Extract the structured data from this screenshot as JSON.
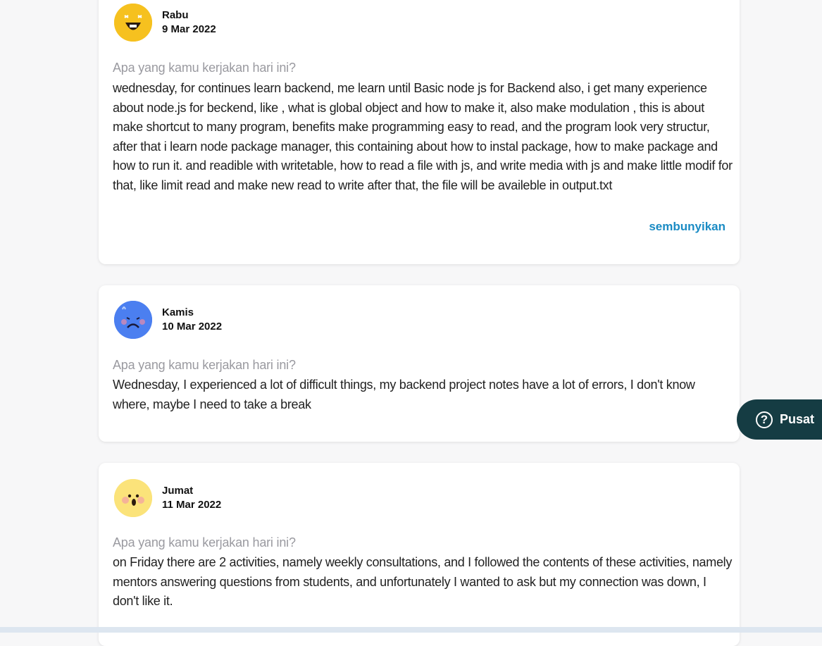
{
  "question_label": "Apa yang kamu kerjakan hari ini?",
  "entries": [
    {
      "mood_icon": "laughing-face-icon",
      "day": "Rabu",
      "date": "9 Mar 2022",
      "answer": "wednesday, for continues learn backend, me learn until Basic node js for Backend also, i get many experience about node.js for beckend, like , what is global object and how to make it, also make modulation , this is about make shortcut to many program, benefits make programming easy to read, and the program look very structur, after that i learn node package manager, this containing about how to instal package, how to make package and how to run it. and readible with writetable, how to read a file with js, and write media with js and make little modif for that, like limit read and make new read to write after that, the file will be availeble in output.txt",
      "toggle_label": "sembunyikan"
    },
    {
      "mood_icon": "sad-face-icon",
      "day": "Kamis",
      "date": "10 Mar 2022",
      "answer": "Wednesday, I experienced a lot of difficult things, my backend project notes have a lot of errors, I don't know where, maybe I need to take a break"
    },
    {
      "mood_icon": "surprised-face-icon",
      "day": "Jumat",
      "date": "11 Mar 2022",
      "answer": "on Friday there are 2 activities, namely weekly consultations, and I followed the contents of these activities, namely mentors answering questions from students, and unfortunately I wanted to ask but my connection was down, I don't like it."
    }
  ],
  "help_button": {
    "icon": "question-circle-icon",
    "label": "Pusat"
  },
  "colors": {
    "link": "#1a8bc4",
    "help_bg": "#153c43",
    "question": "#9a9aa0"
  }
}
